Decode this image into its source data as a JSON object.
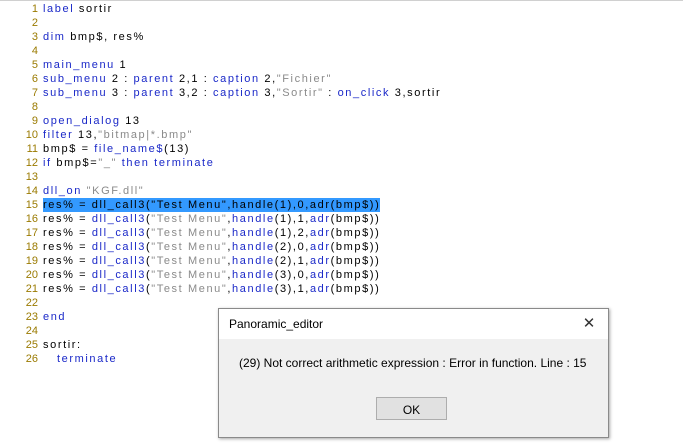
{
  "editor": {
    "lines": [
      {
        "n": "1",
        "tokens": [
          {
            "c": "kw",
            "t": "label "
          },
          {
            "c": "t",
            "t": "sortir"
          }
        ]
      },
      {
        "n": "2",
        "tokens": []
      },
      {
        "n": "3",
        "tokens": [
          {
            "c": "kw",
            "t": "dim "
          },
          {
            "c": "t",
            "t": "bmp$, res%"
          }
        ]
      },
      {
        "n": "4",
        "tokens": []
      },
      {
        "n": "5",
        "tokens": [
          {
            "c": "kw",
            "t": "main_menu "
          },
          {
            "c": "t",
            "t": "1"
          }
        ]
      },
      {
        "n": "6",
        "tokens": [
          {
            "c": "kw",
            "t": "sub_menu "
          },
          {
            "c": "t",
            "t": "2 : "
          },
          {
            "c": "kw",
            "t": "parent "
          },
          {
            "c": "t",
            "t": "2,1 : "
          },
          {
            "c": "kw",
            "t": "caption "
          },
          {
            "c": "t",
            "t": "2,"
          },
          {
            "c": "s",
            "t": "\"Fichier\""
          }
        ]
      },
      {
        "n": "7",
        "tokens": [
          {
            "c": "kw",
            "t": "sub_menu "
          },
          {
            "c": "t",
            "t": "3 : "
          },
          {
            "c": "kw",
            "t": "parent "
          },
          {
            "c": "t",
            "t": "3,2 : "
          },
          {
            "c": "kw",
            "t": "caption "
          },
          {
            "c": "t",
            "t": "3,"
          },
          {
            "c": "s",
            "t": "\"Sortir\""
          },
          {
            "c": "t",
            "t": " : "
          },
          {
            "c": "kw",
            "t": "on_click "
          },
          {
            "c": "t",
            "t": "3,sortir"
          }
        ]
      },
      {
        "n": "8",
        "tokens": []
      },
      {
        "n": "9",
        "tokens": [
          {
            "c": "kw",
            "t": "open_dialog "
          },
          {
            "c": "t",
            "t": "13"
          }
        ]
      },
      {
        "n": "10",
        "tokens": [
          {
            "c": "kw",
            "t": "filter "
          },
          {
            "c": "t",
            "t": "13,"
          },
          {
            "c": "s",
            "t": "\"bitmap|*.bmp\""
          }
        ]
      },
      {
        "n": "11",
        "tokens": [
          {
            "c": "t",
            "t": "bmp$ = "
          },
          {
            "c": "fn",
            "t": "file_name$"
          },
          {
            "c": "t",
            "t": "(13)"
          }
        ]
      },
      {
        "n": "12",
        "tokens": [
          {
            "c": "kw",
            "t": "if "
          },
          {
            "c": "t",
            "t": "bmp$="
          },
          {
            "c": "s",
            "t": "\"_\""
          },
          {
            "c": "kw",
            "t": " then terminate"
          }
        ]
      },
      {
        "n": "13",
        "tokens": []
      },
      {
        "n": "14",
        "tokens": [
          {
            "c": "kw",
            "t": "dll_on "
          },
          {
            "c": "s",
            "t": "\"KGF.dll\""
          }
        ]
      },
      {
        "n": "15",
        "hl": true,
        "tokens": [
          {
            "c": "t",
            "t": "res% = dll_call3(\"Test Menu\",handle(1),0,adr(bmp$))"
          }
        ]
      },
      {
        "n": "16",
        "tokens": [
          {
            "c": "t",
            "t": "res% = "
          },
          {
            "c": "fn",
            "t": "dll_call3"
          },
          {
            "c": "t",
            "t": "("
          },
          {
            "c": "s",
            "t": "\"Test Menu\""
          },
          {
            "c": "t",
            "t": ","
          },
          {
            "c": "fn",
            "t": "handle"
          },
          {
            "c": "t",
            "t": "(1),1,"
          },
          {
            "c": "fn",
            "t": "adr"
          },
          {
            "c": "t",
            "t": "(bmp$))"
          }
        ]
      },
      {
        "n": "17",
        "tokens": [
          {
            "c": "t",
            "t": "res% = "
          },
          {
            "c": "fn",
            "t": "dll_call3"
          },
          {
            "c": "t",
            "t": "("
          },
          {
            "c": "s",
            "t": "\"Test Menu\""
          },
          {
            "c": "t",
            "t": ","
          },
          {
            "c": "fn",
            "t": "handle"
          },
          {
            "c": "t",
            "t": "(1),2,"
          },
          {
            "c": "fn",
            "t": "adr"
          },
          {
            "c": "t",
            "t": "(bmp$))"
          }
        ]
      },
      {
        "n": "18",
        "tokens": [
          {
            "c": "t",
            "t": "res% = "
          },
          {
            "c": "fn",
            "t": "dll_call3"
          },
          {
            "c": "t",
            "t": "("
          },
          {
            "c": "s",
            "t": "\"Test Menu\""
          },
          {
            "c": "t",
            "t": ","
          },
          {
            "c": "fn",
            "t": "handle"
          },
          {
            "c": "t",
            "t": "(2),0,"
          },
          {
            "c": "fn",
            "t": "adr"
          },
          {
            "c": "t",
            "t": "(bmp$))"
          }
        ]
      },
      {
        "n": "19",
        "tokens": [
          {
            "c": "t",
            "t": "res% = "
          },
          {
            "c": "fn",
            "t": "dll_call3"
          },
          {
            "c": "t",
            "t": "("
          },
          {
            "c": "s",
            "t": "\"Test Menu\""
          },
          {
            "c": "t",
            "t": ","
          },
          {
            "c": "fn",
            "t": "handle"
          },
          {
            "c": "t",
            "t": "(2),1,"
          },
          {
            "c": "fn",
            "t": "adr"
          },
          {
            "c": "t",
            "t": "(bmp$))"
          }
        ]
      },
      {
        "n": "20",
        "tokens": [
          {
            "c": "t",
            "t": "res% = "
          },
          {
            "c": "fn",
            "t": "dll_call3"
          },
          {
            "c": "t",
            "t": "("
          },
          {
            "c": "s",
            "t": "\"Test Menu\""
          },
          {
            "c": "t",
            "t": ","
          },
          {
            "c": "fn",
            "t": "handle"
          },
          {
            "c": "t",
            "t": "(3),0,"
          },
          {
            "c": "fn",
            "t": "adr"
          },
          {
            "c": "t",
            "t": "(bmp$))"
          }
        ]
      },
      {
        "n": "21",
        "tokens": [
          {
            "c": "t",
            "t": "res% = "
          },
          {
            "c": "fn",
            "t": "dll_call3"
          },
          {
            "c": "t",
            "t": "("
          },
          {
            "c": "s",
            "t": "\"Test Menu\""
          },
          {
            "c": "t",
            "t": ","
          },
          {
            "c": "fn",
            "t": "handle"
          },
          {
            "c": "t",
            "t": "(3),1,"
          },
          {
            "c": "fn",
            "t": "adr"
          },
          {
            "c": "t",
            "t": "(bmp$))"
          }
        ]
      },
      {
        "n": "22",
        "tokens": []
      },
      {
        "n": "23",
        "tokens": [
          {
            "c": "kw",
            "t": "end"
          }
        ]
      },
      {
        "n": "24",
        "tokens": []
      },
      {
        "n": "25",
        "tokens": [
          {
            "c": "t",
            "t": "sortir:"
          }
        ]
      },
      {
        "n": "26",
        "tokens": [
          {
            "c": "kw",
            "t": "   terminate"
          }
        ]
      }
    ]
  },
  "dialog": {
    "title": "Panoramic_editor",
    "close_glyph": "✕",
    "message": "(29) Not correct arithmetic expression : Error in function. Line : 15",
    "ok_label": "OK"
  },
  "colors": {
    "keyword": "#1a28c8",
    "string": "#8a8a8a",
    "line_number": "#9a7a00",
    "selection": "#3399ff"
  }
}
